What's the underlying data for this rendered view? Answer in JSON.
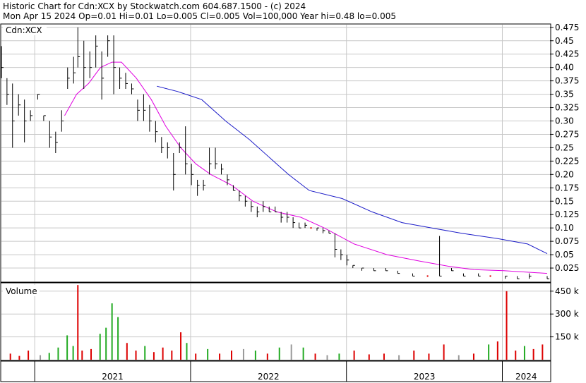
{
  "header": {
    "line1": "Historic Chart for Cdn:XCX by Stockwatch.com 604.687.1500 - (c) 2024",
    "line2": "Mon Apr 15 2024  Op=0.01  Hi=0.01  Lo=0.005  Cl=0.005  Vol=100,000  Year hi=0.48  lo=0.005"
  },
  "price_panel": {
    "label": "Cdn:XCX"
  },
  "volume_panel": {
    "label": "Volume"
  },
  "colors": {
    "grid": "#c8c8c8",
    "price_bar": "#000000",
    "price_dot": "#e00000",
    "ma_short": "#e000e0",
    "ma_long": "#1c1cc8",
    "vol_up": "#22aa22",
    "vol_down": "#dd0000",
    "vol_flat": "#999999"
  },
  "chart_data": [
    {
      "type": "line",
      "title": "Cdn:XCX",
      "x_start": "2020-10-15",
      "x_end": "2024-04-15",
      "ylim": [
        0.0,
        0.48
      ],
      "y_ticks": [
        "0.475",
        "0.45",
        "0.425",
        "0.40",
        "0.375",
        "0.35",
        "0.325",
        "0.30",
        "0.275",
        "0.25",
        "0.225",
        "0.20",
        "0.175",
        "0.15",
        "0.125",
        "0.10",
        "0.075",
        "0.05",
        "0.025"
      ],
      "y_tick_values": [
        0.475,
        0.45,
        0.425,
        0.4,
        0.375,
        0.35,
        0.325,
        0.3,
        0.275,
        0.25,
        0.225,
        0.2,
        0.175,
        0.15,
        0.125,
        0.1,
        0.075,
        0.05,
        0.025
      ],
      "x_labels": [
        "2021",
        "2022",
        "2023",
        "2024"
      ],
      "year_starts": [
        "2021-01-01",
        "2022-01-01",
        "2023-01-01",
        "2024-01-01"
      ],
      "ohlc": [
        {
          "date": "2020-10-15",
          "hi": 0.44,
          "lo": 0.38,
          "cl": 0.4
        },
        {
          "date": "2020-10-28",
          "hi": 0.38,
          "lo": 0.33,
          "cl": 0.35
        },
        {
          "date": "2020-11-10",
          "hi": 0.37,
          "lo": 0.25,
          "cl": 0.3
        },
        {
          "date": "2020-11-24",
          "hi": 0.35,
          "lo": 0.31,
          "cl": 0.33
        },
        {
          "date": "2020-12-08",
          "hi": 0.34,
          "lo": 0.26,
          "cl": 0.3
        },
        {
          "date": "2020-12-22",
          "hi": 0.32,
          "lo": 0.3,
          "cl": 0.31
        },
        {
          "date": "2021-01-08",
          "hi": 0.35,
          "lo": 0.34,
          "cl": 0.35
        },
        {
          "date": "2021-01-22",
          "hi": 0.31,
          "lo": 0.3,
          "cl": 0.31
        },
        {
          "date": "2021-02-05",
          "hi": 0.3,
          "lo": 0.25,
          "cl": 0.27
        },
        {
          "date": "2021-02-19",
          "hi": 0.28,
          "lo": 0.24,
          "cl": 0.26
        },
        {
          "date": "2021-03-05",
          "hi": 0.32,
          "lo": 0.28,
          "cl": 0.3
        },
        {
          "date": "2021-03-19",
          "hi": 0.4,
          "lo": 0.36,
          "cl": 0.38
        },
        {
          "date": "2021-04-02",
          "hi": 0.42,
          "lo": 0.37,
          "cl": 0.39
        },
        {
          "date": "2021-04-12",
          "hi": 0.475,
          "lo": 0.4,
          "cl": 0.42
        },
        {
          "date": "2021-04-26",
          "hi": 0.45,
          "lo": 0.36,
          "cl": 0.4
        },
        {
          "date": "2021-05-10",
          "hi": 0.43,
          "lo": 0.38,
          "cl": 0.4
        },
        {
          "date": "2021-05-24",
          "hi": 0.46,
          "lo": 0.4,
          "cl": 0.44
        },
        {
          "date": "2021-06-07",
          "hi": 0.43,
          "lo": 0.34,
          "cl": 0.38
        },
        {
          "date": "2021-06-21",
          "hi": 0.46,
          "lo": 0.42,
          "cl": 0.45
        },
        {
          "date": "2021-07-05",
          "hi": 0.46,
          "lo": 0.35,
          "cl": 0.4
        },
        {
          "date": "2021-07-19",
          "hi": 0.4,
          "lo": 0.36,
          "cl": 0.38
        },
        {
          "date": "2021-08-02",
          "hi": 0.39,
          "lo": 0.36,
          "cl": 0.37
        },
        {
          "date": "2021-08-16",
          "hi": 0.37,
          "lo": 0.35,
          "cl": 0.36
        },
        {
          "date": "2021-08-30",
          "hi": 0.34,
          "lo": 0.3,
          "cl": 0.32
        },
        {
          "date": "2021-09-13",
          "hi": 0.35,
          "lo": 0.3,
          "cl": 0.32
        },
        {
          "date": "2021-09-27",
          "hi": 0.33,
          "lo": 0.28,
          "cl": 0.3
        },
        {
          "date": "2021-10-11",
          "hi": 0.3,
          "lo": 0.26,
          "cl": 0.28
        },
        {
          "date": "2021-10-25",
          "hi": 0.27,
          "lo": 0.24,
          "cl": 0.25
        },
        {
          "date": "2021-11-08",
          "hi": 0.26,
          "lo": 0.23,
          "cl": 0.25
        },
        {
          "date": "2021-11-22",
          "hi": 0.24,
          "lo": 0.17,
          "cl": 0.2
        },
        {
          "date": "2021-12-06",
          "hi": 0.26,
          "lo": 0.24,
          "cl": 0.25
        },
        {
          "date": "2021-12-20",
          "hi": 0.29,
          "lo": 0.2,
          "cl": 0.22
        },
        {
          "date": "2022-01-03",
          "hi": 0.22,
          "lo": 0.18,
          "cl": 0.2
        },
        {
          "date": "2022-01-17",
          "hi": 0.19,
          "lo": 0.16,
          "cl": 0.18
        },
        {
          "date": "2022-01-31",
          "hi": 0.19,
          "lo": 0.17,
          "cl": 0.18
        },
        {
          "date": "2022-02-14",
          "hi": 0.25,
          "lo": 0.2,
          "cl": 0.22
        },
        {
          "date": "2022-02-28",
          "hi": 0.25,
          "lo": 0.21,
          "cl": 0.22
        },
        {
          "date": "2022-03-14",
          "hi": 0.22,
          "lo": 0.2,
          "cl": 0.21
        },
        {
          "date": "2022-03-28",
          "hi": 0.2,
          "lo": 0.18,
          "cl": 0.19
        },
        {
          "date": "2022-04-11",
          "hi": 0.18,
          "lo": 0.17,
          "cl": 0.17
        },
        {
          "date": "2022-04-25",
          "hi": 0.17,
          "lo": 0.15,
          "cl": 0.16
        },
        {
          "date": "2022-05-09",
          "hi": 0.16,
          "lo": 0.14,
          "cl": 0.15
        },
        {
          "date": "2022-05-23",
          "hi": 0.15,
          "lo": 0.13,
          "cl": 0.14
        },
        {
          "date": "2022-06-06",
          "hi": 0.14,
          "lo": 0.12,
          "cl": 0.13
        },
        {
          "date": "2022-06-20",
          "hi": 0.15,
          "lo": 0.13,
          "cl": 0.14
        },
        {
          "date": "2022-07-04",
          "hi": 0.14,
          "lo": 0.13,
          "cl": 0.13
        },
        {
          "date": "2022-07-18",
          "hi": 0.14,
          "lo": 0.13,
          "cl": 0.13
        },
        {
          "date": "2022-08-01",
          "hi": 0.13,
          "lo": 0.11,
          "cl": 0.12
        },
        {
          "date": "2022-08-15",
          "hi": 0.13,
          "lo": 0.11,
          "cl": 0.12
        },
        {
          "date": "2022-08-29",
          "hi": 0.12,
          "lo": 0.1,
          "cl": 0.11
        },
        {
          "date": "2022-09-12",
          "hi": 0.11,
          "lo": 0.1,
          "cl": 0.1
        },
        {
          "date": "2022-09-26",
          "hi": 0.11,
          "lo": 0.1,
          "cl": 0.105
        },
        {
          "date": "2022-10-10",
          "hi": 0.1,
          "lo": 0.1,
          "cl": 0.1
        },
        {
          "date": "2022-10-24",
          "hi": 0.1,
          "lo": 0.095,
          "cl": 0.1
        },
        {
          "date": "2022-11-07",
          "hi": 0.1,
          "lo": 0.09,
          "cl": 0.095
        },
        {
          "date": "2022-11-21",
          "hi": 0.095,
          "lo": 0.09,
          "cl": 0.09
        },
        {
          "date": "2022-12-05",
          "hi": 0.09,
          "lo": 0.045,
          "cl": 0.06
        },
        {
          "date": "2022-12-19",
          "hi": 0.06,
          "lo": 0.04,
          "cl": 0.05
        },
        {
          "date": "2023-01-02",
          "hi": 0.05,
          "lo": 0.03,
          "cl": 0.04
        },
        {
          "date": "2023-01-16",
          "hi": 0.03,
          "lo": 0.025,
          "cl": 0.03
        },
        {
          "date": "2023-02-06",
          "hi": 0.025,
          "lo": 0.02,
          "cl": 0.025
        },
        {
          "date": "2023-03-06",
          "hi": 0.025,
          "lo": 0.02,
          "cl": 0.02
        },
        {
          "date": "2023-04-03",
          "hi": 0.025,
          "lo": 0.02,
          "cl": 0.02
        },
        {
          "date": "2023-05-01",
          "hi": 0.02,
          "lo": 0.015,
          "cl": 0.015
        },
        {
          "date": "2023-06-05",
          "hi": 0.015,
          "lo": 0.01,
          "cl": 0.01
        },
        {
          "date": "2023-07-10",
          "hi": 0.01,
          "lo": 0.01,
          "cl": 0.01
        },
        {
          "date": "2023-08-07",
          "hi": 0.085,
          "lo": 0.01,
          "cl": 0.01
        },
        {
          "date": "2023-09-04",
          "hi": 0.025,
          "lo": 0.02,
          "cl": 0.02
        },
        {
          "date": "2023-10-02",
          "hi": 0.015,
          "lo": 0.01,
          "cl": 0.01
        },
        {
          "date": "2023-11-06",
          "hi": 0.015,
          "lo": 0.01,
          "cl": 0.01
        },
        {
          "date": "2023-12-04",
          "hi": 0.01,
          "lo": 0.01,
          "cl": 0.01
        },
        {
          "date": "2024-01-08",
          "hi": 0.01,
          "lo": 0.005,
          "cl": 0.01
        },
        {
          "date": "2024-02-05",
          "hi": 0.01,
          "lo": 0.005,
          "cl": 0.005
        },
        {
          "date": "2024-03-04",
          "hi": 0.015,
          "lo": 0.005,
          "cl": 0.01
        },
        {
          "date": "2024-04-15",
          "hi": 0.01,
          "lo": 0.005,
          "cl": 0.005
        }
      ],
      "ma_short": [
        {
          "date": "2021-03-12",
          "v": 0.31
        },
        {
          "date": "2021-03-26",
          "v": 0.33
        },
        {
          "date": "2021-04-09",
          "v": 0.35
        },
        {
          "date": "2021-05-07",
          "v": 0.37
        },
        {
          "date": "2021-06-04",
          "v": 0.4
        },
        {
          "date": "2021-07-01",
          "v": 0.41
        },
        {
          "date": "2021-07-23",
          "v": 0.41
        },
        {
          "date": "2021-08-27",
          "v": 0.38
        },
        {
          "date": "2021-10-01",
          "v": 0.34
        },
        {
          "date": "2021-11-04",
          "v": 0.29
        },
        {
          "date": "2021-12-09",
          "v": 0.25
        },
        {
          "date": "2022-01-13",
          "v": 0.22
        },
        {
          "date": "2022-02-17",
          "v": 0.2
        },
        {
          "date": "2022-04-07",
          "v": 0.18
        },
        {
          "date": "2022-05-27",
          "v": 0.15
        },
        {
          "date": "2022-07-22",
          "v": 0.13
        },
        {
          "date": "2022-09-16",
          "v": 0.12
        },
        {
          "date": "2022-11-10",
          "v": 0.1
        },
        {
          "date": "2023-01-19",
          "v": 0.07
        },
        {
          "date": "2023-04-06",
          "v": 0.05
        },
        {
          "date": "2023-06-22",
          "v": 0.038
        },
        {
          "date": "2023-08-31",
          "v": 0.028
        },
        {
          "date": "2023-10-26",
          "v": 0.022
        },
        {
          "date": "2024-01-04",
          "v": 0.02
        },
        {
          "date": "2024-04-15",
          "v": 0.015
        }
      ],
      "ma_long": [
        {
          "date": "2021-10-14",
          "v": 0.365
        },
        {
          "date": "2021-12-02",
          "v": 0.355
        },
        {
          "date": "2022-01-27",
          "v": 0.34
        },
        {
          "date": "2022-03-24",
          "v": 0.3
        },
        {
          "date": "2022-05-19",
          "v": 0.265
        },
        {
          "date": "2022-07-07",
          "v": 0.23
        },
        {
          "date": "2022-08-18",
          "v": 0.2
        },
        {
          "date": "2022-10-06",
          "v": 0.17
        },
        {
          "date": "2022-12-22",
          "v": 0.155
        },
        {
          "date": "2023-03-02",
          "v": 0.13
        },
        {
          "date": "2023-05-11",
          "v": 0.11
        },
        {
          "date": "2023-07-20",
          "v": 0.1
        },
        {
          "date": "2023-09-28",
          "v": 0.09
        },
        {
          "date": "2023-12-21",
          "v": 0.08
        },
        {
          "date": "2024-02-29",
          "v": 0.07
        },
        {
          "date": "2024-04-15",
          "v": 0.052
        }
      ]
    },
    {
      "type": "bar",
      "title": "Volume",
      "ylim": [
        0,
        500000
      ],
      "y_ticks": [
        "450 k",
        "300 k",
        "150 k"
      ],
      "y_tick_values": [
        450000,
        300000,
        150000
      ],
      "bars": [
        {
          "date": "2020-11-05",
          "v": 40000,
          "c": "down"
        },
        {
          "date": "2020-11-26",
          "v": 25000,
          "c": "down"
        },
        {
          "date": "2020-12-17",
          "v": 60000,
          "c": "down"
        },
        {
          "date": "2021-01-14",
          "v": 30000,
          "c": "flat"
        },
        {
          "date": "2021-02-04",
          "v": 45000,
          "c": "up"
        },
        {
          "date": "2021-02-25",
          "v": 80000,
          "c": "up"
        },
        {
          "date": "2021-03-18",
          "v": 160000,
          "c": "up"
        },
        {
          "date": "2021-04-01",
          "v": 90000,
          "c": "up"
        },
        {
          "date": "2021-04-12",
          "v": 490000,
          "c": "down"
        },
        {
          "date": "2021-04-22",
          "v": 60000,
          "c": "down"
        },
        {
          "date": "2021-05-13",
          "v": 70000,
          "c": "down"
        },
        {
          "date": "2021-06-03",
          "v": 170000,
          "c": "up"
        },
        {
          "date": "2021-06-17",
          "v": 210000,
          "c": "up"
        },
        {
          "date": "2021-07-01",
          "v": 370000,
          "c": "up"
        },
        {
          "date": "2021-07-15",
          "v": 280000,
          "c": "up"
        },
        {
          "date": "2021-08-05",
          "v": 110000,
          "c": "down"
        },
        {
          "date": "2021-08-26",
          "v": 60000,
          "c": "down"
        },
        {
          "date": "2021-09-16",
          "v": 90000,
          "c": "up"
        },
        {
          "date": "2021-10-07",
          "v": 50000,
          "c": "down"
        },
        {
          "date": "2021-10-28",
          "v": 80000,
          "c": "down"
        },
        {
          "date": "2021-11-18",
          "v": 60000,
          "c": "down"
        },
        {
          "date": "2021-12-09",
          "v": 180000,
          "c": "down"
        },
        {
          "date": "2021-12-23",
          "v": 110000,
          "c": "up"
        },
        {
          "date": "2022-01-13",
          "v": 40000,
          "c": "down"
        },
        {
          "date": "2022-02-10",
          "v": 70000,
          "c": "up"
        },
        {
          "date": "2022-03-10",
          "v": 40000,
          "c": "down"
        },
        {
          "date": "2022-04-07",
          "v": 60000,
          "c": "down"
        },
        {
          "date": "2022-05-05",
          "v": 70000,
          "c": "flat"
        },
        {
          "date": "2022-06-02",
          "v": 60000,
          "c": "up"
        },
        {
          "date": "2022-06-30",
          "v": 40000,
          "c": "down"
        },
        {
          "date": "2022-07-28",
          "v": 80000,
          "c": "up"
        },
        {
          "date": "2022-08-25",
          "v": 100000,
          "c": "flat"
        },
        {
          "date": "2022-09-22",
          "v": 80000,
          "c": "up"
        },
        {
          "date": "2022-10-20",
          "v": 40000,
          "c": "down"
        },
        {
          "date": "2022-11-17",
          "v": 30000,
          "c": "flat"
        },
        {
          "date": "2022-12-15",
          "v": 40000,
          "c": "up"
        },
        {
          "date": "2023-01-19",
          "v": 60000,
          "c": "down"
        },
        {
          "date": "2023-02-23",
          "v": 35000,
          "c": "down"
        },
        {
          "date": "2023-03-30",
          "v": 40000,
          "c": "down"
        },
        {
          "date": "2023-05-04",
          "v": 30000,
          "c": "flat"
        },
        {
          "date": "2023-06-08",
          "v": 60000,
          "c": "down"
        },
        {
          "date": "2023-07-13",
          "v": 40000,
          "c": "down"
        },
        {
          "date": "2023-08-17",
          "v": 100000,
          "c": "down"
        },
        {
          "date": "2023-09-21",
          "v": 30000,
          "c": "flat"
        },
        {
          "date": "2023-10-26",
          "v": 40000,
          "c": "down"
        },
        {
          "date": "2023-11-30",
          "v": 100000,
          "c": "up"
        },
        {
          "date": "2023-12-21",
          "v": 120000,
          "c": "down"
        },
        {
          "date": "2024-01-11",
          "v": 450000,
          "c": "down"
        },
        {
          "date": "2024-02-01",
          "v": 60000,
          "c": "down"
        },
        {
          "date": "2024-02-22",
          "v": 90000,
          "c": "up"
        },
        {
          "date": "2024-03-14",
          "v": 70000,
          "c": "down"
        },
        {
          "date": "2024-04-04",
          "v": 100000,
          "c": "down"
        }
      ]
    }
  ]
}
